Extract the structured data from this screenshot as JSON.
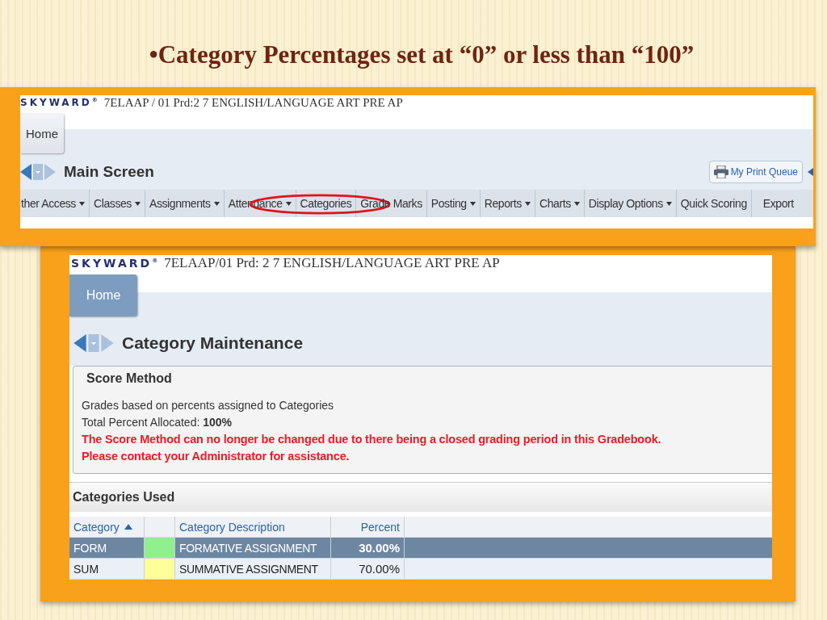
{
  "slide_title": "•Category Percentages set at “0” or less than “100”",
  "screen_1": {
    "logo": "SKYWARD$^{®}$",
    "course": "7ELAAP / 01 Prd:2 7 ENGLISH/LANGUAGE ART PRE AP",
    "home_tab": {
      "label": "Home",
      "selected": false
    },
    "page_title": "Main Screen",
    "print_queue": "My Print Queue",
    "menu": [
      {
        "label": "ther Access",
        "dropdown": true,
        "highlighted": false
      },
      {
        "label": "Classes",
        "dropdown": true,
        "highlighted": false
      },
      {
        "label": "Assignments",
        "dropdown": true,
        "highlighted": false
      },
      {
        "label": "Attendance",
        "dropdown": true,
        "highlighted": false
      },
      {
        "label": "Categories",
        "dropdown": false,
        "highlighted": true
      },
      {
        "label": "Grade Marks",
        "dropdown": false,
        "highlighted": false
      },
      {
        "label": "Posting",
        "dropdown": true,
        "highlighted": false
      },
      {
        "label": "Reports",
        "dropdown": true,
        "highlighted": false
      },
      {
        "label": "Charts",
        "dropdown": true,
        "highlighted": false
      },
      {
        "label": "Display Options",
        "dropdown": true,
        "highlighted": false
      },
      {
        "label": "Quick Scoring",
        "dropdown": false,
        "highlighted": false
      },
      {
        "label": "Export",
        "dropdown": false,
        "highlighted": false
      }
    ]
  },
  "screen_2": {
    "logo": "SKYWARD$^{®}$",
    "course": "7ELAAP/01  Prd: 2  7 ENGLISH/LANGUAGE ART PRE AP",
    "home_tab": {
      "label": "Home",
      "selected": true
    },
    "page_title": "Category Maintenance",
    "score_method": {
      "title": "Score Method",
      "lines": [
        "Grades based on percents assigned to Categories",
        "Total Percent Allocated: **100%**"
      ],
      "warnings": [
        "The Score Method can no longer be changed due to there being a closed grading period in this Gradebook.",
        "Please contact your Administrator for assistance."
      ]
    },
    "categories_used": {
      "title": "Categories Used",
      "columns": [
        "Category",
        "Category Description",
        "Percent"
      ],
      "rows": [
        {
          "category": "FORM",
          "color": "#90f090",
          "description": "FORMATIVE ASSIGNMENT",
          "percent": "30.00%",
          "selected": true
        },
        {
          "category": "SUM",
          "color": "#ffff99",
          "description": "SUMMATIVE ASSIGNMENT",
          "percent": "70.00%",
          "selected": false
        }
      ]
    }
  }
}
